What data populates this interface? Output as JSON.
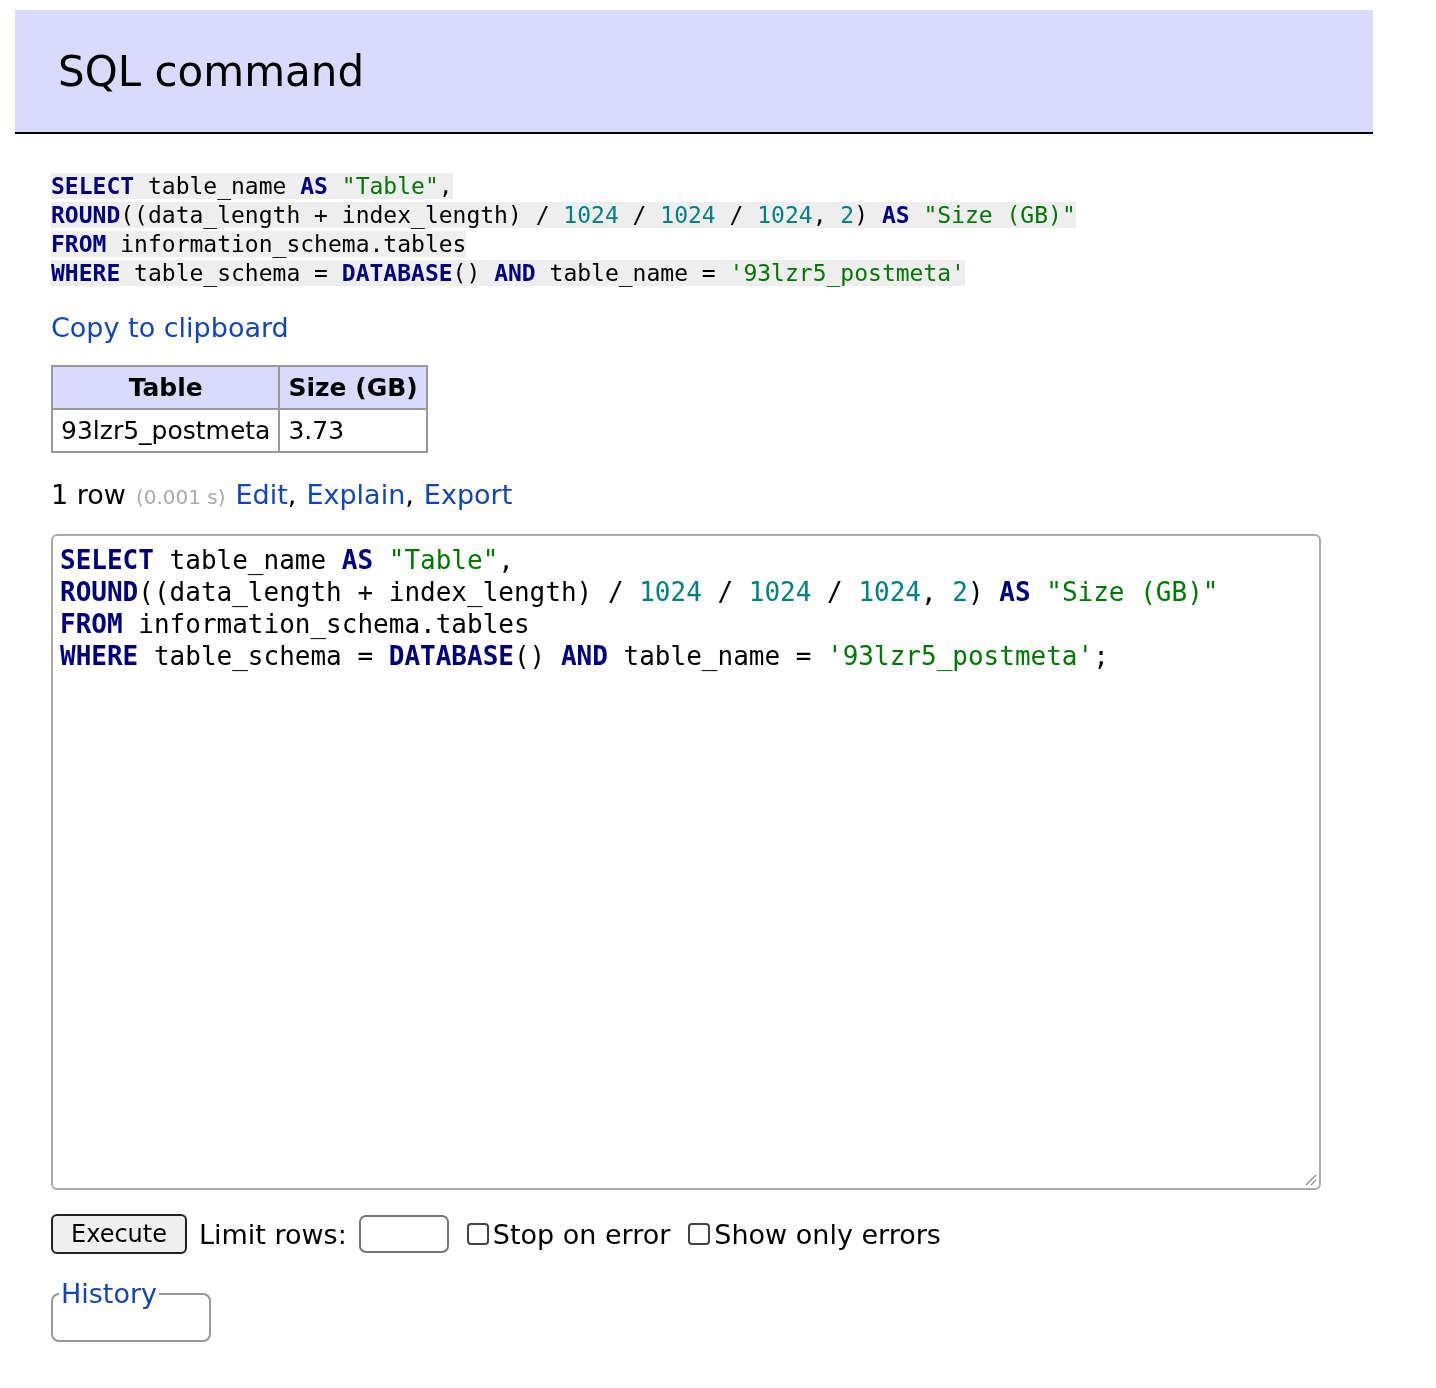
{
  "header": {
    "title": "SQL command"
  },
  "query": {
    "lines": [
      [
        {
          "kind": "keyword",
          "text": "SELECT"
        },
        {
          "kind": "plain",
          "text": " table_name "
        },
        {
          "kind": "keyword",
          "text": "AS "
        },
        {
          "kind": "string",
          "text": "\"Table\""
        },
        {
          "kind": "plain",
          "text": ","
        }
      ],
      [
        {
          "kind": "keyword",
          "text": "ROUND"
        },
        {
          "kind": "plain",
          "text": "((data_length + index_length) / "
        },
        {
          "kind": "number",
          "text": "1024"
        },
        {
          "kind": "plain",
          "text": " / "
        },
        {
          "kind": "number",
          "text": "1024"
        },
        {
          "kind": "plain",
          "text": " / "
        },
        {
          "kind": "number",
          "text": "1024"
        },
        {
          "kind": "plain",
          "text": ", "
        },
        {
          "kind": "number",
          "text": "2"
        },
        {
          "kind": "plain",
          "text": ") "
        },
        {
          "kind": "keyword",
          "text": "AS "
        },
        {
          "kind": "string",
          "text": "\"Size (GB)\""
        }
      ],
      [
        {
          "kind": "keyword",
          "text": "FROM"
        },
        {
          "kind": "plain",
          "text": " information_schema.tables"
        }
      ],
      [
        {
          "kind": "keyword",
          "text": "WHERE"
        },
        {
          "kind": "plain",
          "text": " table_schema = "
        },
        {
          "kind": "keyword",
          "text": "DATABASE"
        },
        {
          "kind": "plain",
          "text": "() "
        },
        {
          "kind": "keyword",
          "text": "AND"
        },
        {
          "kind": "plain",
          "text": " table_name = "
        },
        {
          "kind": "string",
          "text": "'93lzr5_postmeta'"
        }
      ]
    ]
  },
  "copy_link": "Copy to clipboard",
  "results": {
    "columns": [
      "Table",
      "Size (GB)"
    ],
    "rows": [
      [
        "93lzr5_postmeta",
        "3.73"
      ]
    ]
  },
  "summary": {
    "count": "1 row",
    "time": "(0.001 s)",
    "links": [
      {
        "label": "Edit",
        "after": ","
      },
      {
        "label": "Explain",
        "after": ","
      },
      {
        "label": "Export"
      }
    ]
  },
  "editor": {
    "lines": [
      [
        {
          "kind": "keyword",
          "text": "SELECT"
        },
        {
          "kind": "plain",
          "text": " table_name "
        },
        {
          "kind": "keyword",
          "text": "AS "
        },
        {
          "kind": "string",
          "text": "\"Table\""
        },
        {
          "kind": "plain",
          "text": ","
        }
      ],
      [
        {
          "kind": "keyword",
          "text": "ROUND"
        },
        {
          "kind": "plain",
          "text": "((data_length + index_length) / "
        },
        {
          "kind": "number",
          "text": "1024"
        },
        {
          "kind": "plain",
          "text": " / "
        },
        {
          "kind": "number",
          "text": "1024"
        },
        {
          "kind": "plain",
          "text": " / "
        },
        {
          "kind": "number",
          "text": "1024"
        },
        {
          "kind": "plain",
          "text": ", "
        },
        {
          "kind": "number",
          "text": "2"
        },
        {
          "kind": "plain",
          "text": ") "
        },
        {
          "kind": "keyword",
          "text": "AS "
        },
        {
          "kind": "string",
          "text": "\"Size (GB)\""
        }
      ],
      [
        {
          "kind": "keyword",
          "text": "FROM"
        },
        {
          "kind": "plain",
          "text": " information_schema.tables"
        }
      ],
      [
        {
          "kind": "keyword",
          "text": "WHERE"
        },
        {
          "kind": "plain",
          "text": " table_schema = "
        },
        {
          "kind": "keyword",
          "text": "DATABASE"
        },
        {
          "kind": "plain",
          "text": "() "
        },
        {
          "kind": "keyword",
          "text": "AND"
        },
        {
          "kind": "plain",
          "text": " table_name = "
        },
        {
          "kind": "string",
          "text": "'93lzr5_postmeta'"
        },
        {
          "kind": "plain",
          "text": ";"
        }
      ]
    ]
  },
  "execute_button": "Execute",
  "limit": {
    "label": "Limit rows:"
  },
  "options": [
    {
      "label": "Stop on error",
      "checked": false
    },
    {
      "label": "Show only errors",
      "checked": false
    }
  ],
  "history": {
    "legend": "History"
  }
}
